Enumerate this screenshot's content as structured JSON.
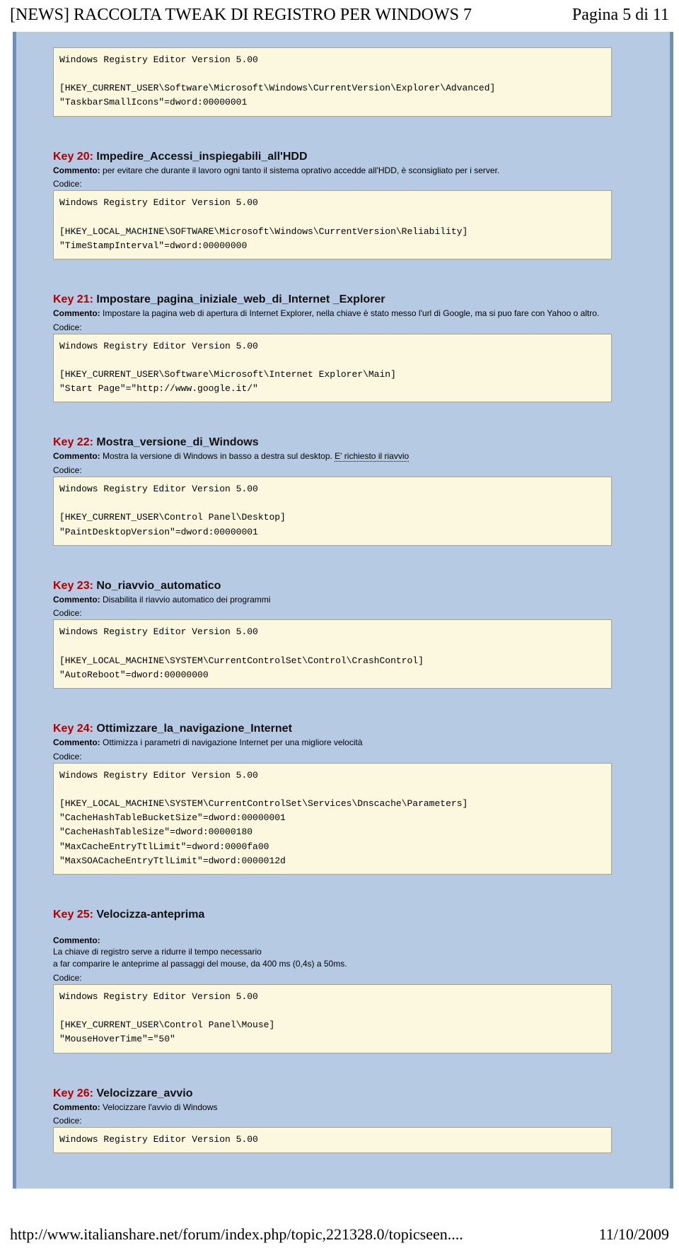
{
  "header": {
    "title": "[NEWS] RACCOLTA TWEAK DI REGISTRO PER WINDOWS 7",
    "page_info": "Pagina 5 di 11"
  },
  "labels": {
    "commento": "Commento:",
    "codice": "Codice:"
  },
  "top_code": "Windows Registry Editor Version 5.00\n\n[HKEY_CURRENT_USER\\Software\\Microsoft\\Windows\\CurrentVersion\\Explorer\\Advanced]\n\"TaskbarSmallIcons\"=dword:00000001",
  "keys": [
    {
      "num": "Key 20:",
      "title": "Impedire_Accessi_inspiegabili_all'HDD",
      "comment": "per evitare che durante il lavoro ogni tanto il sistema oprativo accedde all'HDD, è sconsigliato per i server.",
      "code": "Windows Registry Editor Version 5.00\n\n[HKEY_LOCAL_MACHINE\\SOFTWARE\\Microsoft\\Windows\\CurrentVersion\\Reliability]\n\"TimeStampInterval\"=dword:00000000"
    },
    {
      "num": "Key 21:",
      "title": "Impostare_pagina_iniziale_web_di_Internet _Explorer",
      "comment": "Impostare la pagina web di apertura di Internet Explorer, nella chiave è stato messo l'url di Google, ma si puo fare con Yahoo o altro.",
      "code": "Windows Registry Editor Version 5.00\n\n[HKEY_CURRENT_USER\\Software\\Microsoft\\Internet Explorer\\Main]\n\"Start Page\"=\"http://www.google.it/\""
    },
    {
      "num": "Key 22:",
      "title": "Mostra_versione_di_Windows",
      "comment": "Mostra la versione di Windows in basso a destra sul desktop. ",
      "comment_dotted": "E' richiesto il riavvio",
      "code": "Windows Registry Editor Version 5.00\n\n[HKEY_CURRENT_USER\\Control Panel\\Desktop]\n\"PaintDesktopVersion\"=dword:00000001"
    },
    {
      "num": "Key 23:",
      "title": "No_riavvio_automatico",
      "comment": "Disabilita il riavvio automatico dei programmi",
      "code": "Windows Registry Editor Version 5.00\n\n[HKEY_LOCAL_MACHINE\\SYSTEM\\CurrentControlSet\\Control\\CrashControl]\n\"AutoReboot\"=dword:00000000"
    },
    {
      "num": "Key 24:",
      "title": "Ottimizzare_la_navigazione_Internet",
      "comment": "Ottimizza i parametri di navigazione Internet per una migliore velocità",
      "code": "Windows Registry Editor Version 5.00\n\n[HKEY_LOCAL_MACHINE\\SYSTEM\\CurrentControlSet\\Services\\Dnscache\\Parameters]\n\"CacheHashTableBucketSize\"=dword:00000001\n\"CacheHashTableSize\"=dword:00000180\n\"MaxCacheEntryTtlLimit\"=dword:0000fa00\n\"MaxSOACacheEntryTtlLimit\"=dword:0000012d"
    },
    {
      "num": "Key 25:",
      "title": "Velocizza-anteprima",
      "comment": "La chiave di registro serve a ridurre il tempo necessario\na far comparire le anteprime al passaggi del mouse, da 400 ms (0,4s) a 50ms.",
      "code": "Windows Registry Editor Version 5.00\n\n[HKEY_CURRENT_USER\\Control Panel\\Mouse]\n\"MouseHoverTime\"=\"50\""
    },
    {
      "num": "Key 26:",
      "title": "Velocizzare_avvio",
      "comment": "Velocizzare l'avvio di Windows",
      "code": "Windows Registry Editor Version 5.00"
    }
  ],
  "footer": {
    "url": "http://www.italianshare.net/forum/index.php/topic,221328.0/topicseen....",
    "date": "11/10/2009"
  }
}
